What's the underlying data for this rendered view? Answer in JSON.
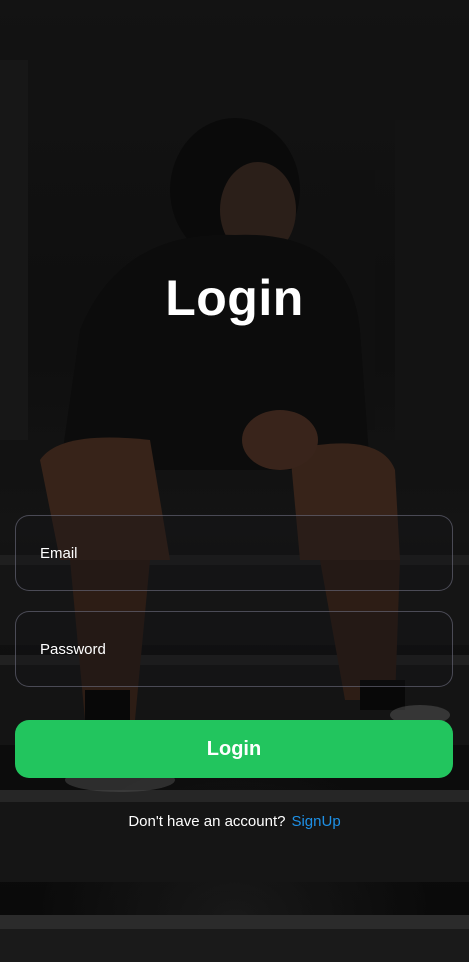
{
  "screen": {
    "title": "Login",
    "background_icon": "athlete-on-stairs-photo"
  },
  "form": {
    "email": {
      "placeholder": "Email",
      "value": ""
    },
    "password": {
      "placeholder": "Password",
      "value": ""
    },
    "submit_label": "Login"
  },
  "signup": {
    "prompt": "Don't have an account?",
    "link_label": "SignUp"
  },
  "colors": {
    "accent": "#22c55e",
    "link": "#1e90e6",
    "text": "#ffffff",
    "field_border": "#78788c"
  }
}
